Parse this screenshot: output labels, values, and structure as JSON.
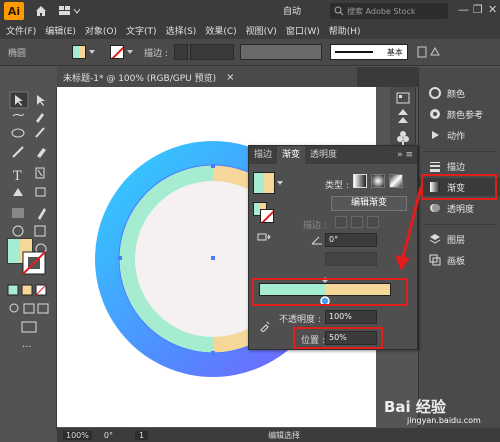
{
  "app": {
    "logo": "Ai",
    "auto_label": "自动",
    "search_placeholder": "搜索 Adobe Stock"
  },
  "window_controls": {
    "minimize": "—",
    "restore": "❐",
    "close": "✕"
  },
  "menu": [
    "文件(F)",
    "编辑(E)",
    "对象(O)",
    "文字(T)",
    "选择(S)",
    "效果(C)",
    "视图(V)",
    "窗口(W)",
    "帮助(H)"
  ],
  "controlbar": {
    "object_label": "椭圆",
    "stroke_label": "描边 :",
    "stroke_style_label": "基本",
    "fill_color": "#a6ecd0"
  },
  "document": {
    "tab_title": "未标题-1* @ 100% (RGB/GPU 预览)",
    "close": "×"
  },
  "dock": {
    "items": [
      {
        "label": "颜色",
        "icon": "color-wheel-icon"
      },
      {
        "label": "颜色参考",
        "icon": "color-guide-icon"
      },
      {
        "label": "动作",
        "icon": "play-icon"
      },
      {
        "label": "描边",
        "icon": "stroke-icon"
      },
      {
        "label": "渐变",
        "icon": "gradient-icon"
      },
      {
        "label": "透明度",
        "icon": "transparency-icon"
      },
      {
        "label": "图层",
        "icon": "layers-icon"
      },
      {
        "label": "画板",
        "icon": "artboards-icon"
      }
    ]
  },
  "gradient_panel": {
    "tabs": [
      "描边",
      "渐变",
      "透明度"
    ],
    "active_tab": "渐变",
    "type_label": "类型 :",
    "edit_button": "编辑渐变",
    "stroke_label": "描边 :",
    "angle_value": "0°",
    "opacity_label": "不透明度 :",
    "opacity_value": "100%",
    "position_label": "位置 :",
    "position_value": "50%",
    "stop_colors": [
      "#a6ecd0",
      "#f5d79a"
    ],
    "stop_position_pct": 50
  },
  "statusbar": {
    "zoom": "100%",
    "angle": "0°",
    "page": "1",
    "tool": "编辑选择"
  },
  "colors": {
    "ring_outer_start": "#2fb4ff",
    "ring_outer_end": "#7b5cff",
    "mint": "#a6ecd0",
    "sand": "#f5d79a",
    "highlight": "#e01e1e"
  },
  "watermark": {
    "brand": "Bai 经验",
    "url": "jingyan.baidu.com"
  }
}
